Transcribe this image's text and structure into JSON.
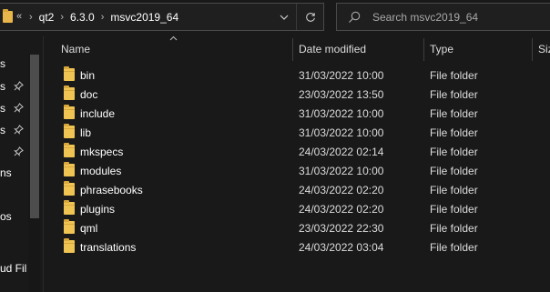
{
  "address_bar": {
    "overflow": "«",
    "breadcrumbs": [
      "qt2",
      "6.3.0",
      "msvc2019_64"
    ],
    "separator": "›"
  },
  "search": {
    "placeholder": "Search msvc2019_64"
  },
  "nav_pane": {
    "items": [
      "s",
      "s",
      "s",
      "s",
      "ns",
      "os",
      "ud Fil"
    ]
  },
  "columns": {
    "name": "Name",
    "date_modified": "Date modified",
    "type": "Type",
    "size": "Siz"
  },
  "files": [
    {
      "name": "bin",
      "date": "31/03/2022 10:00",
      "type": "File folder"
    },
    {
      "name": "doc",
      "date": "23/03/2022 13:50",
      "type": "File folder"
    },
    {
      "name": "include",
      "date": "31/03/2022 10:00",
      "type": "File folder"
    },
    {
      "name": "lib",
      "date": "31/03/2022 10:00",
      "type": "File folder"
    },
    {
      "name": "mkspecs",
      "date": "24/03/2022 02:14",
      "type": "File folder"
    },
    {
      "name": "modules",
      "date": "31/03/2022 10:00",
      "type": "File folder"
    },
    {
      "name": "phrasebooks",
      "date": "24/03/2022 02:20",
      "type": "File folder"
    },
    {
      "name": "plugins",
      "date": "24/03/2022 02:20",
      "type": "File folder"
    },
    {
      "name": "qml",
      "date": "23/03/2022 22:30",
      "type": "File folder"
    },
    {
      "name": "translations",
      "date": "24/03/2022 03:04",
      "type": "File folder"
    }
  ],
  "icons": {
    "address_folder": "folder-icon",
    "dropdown": "chevron-down-icon",
    "refresh": "refresh-icon",
    "search": "search-icon",
    "pin": "pin-icon",
    "sort": "sort-ascending-icon"
  },
  "colors": {
    "background": "#191919",
    "folder": "#f0c453",
    "text": "#ffffff",
    "muted": "#a8a8a8"
  }
}
